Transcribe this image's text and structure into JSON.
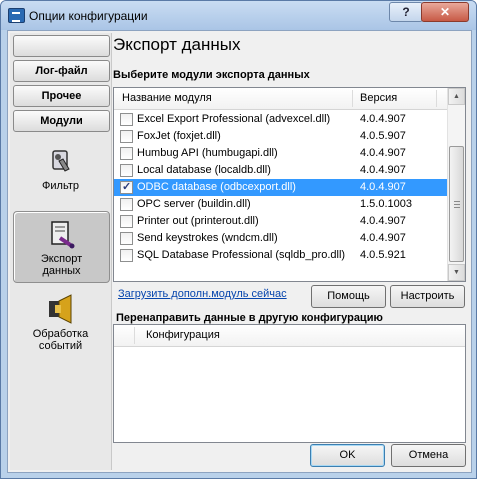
{
  "window": {
    "title": "Опции конфигурации",
    "help_label": "?",
    "close_label": "✕"
  },
  "sidebar": {
    "top_buttons": [
      "",
      "Лог-файл",
      "Прочее",
      "Модули"
    ],
    "nav": [
      {
        "label": "Фильтр",
        "icon": "filter-icon"
      },
      {
        "label": "Экспорт данных",
        "icon": "export-icon",
        "selected": true
      },
      {
        "label": "Обработка событий",
        "icon": "events-icon"
      }
    ]
  },
  "main": {
    "title": "Экспорт данных",
    "modules_group_label": "Выберите модули экспорта данных",
    "columns": {
      "name": "Название модуля",
      "version": "Версия"
    },
    "modules": [
      {
        "name": "Excel Export Professional (advexcel.dll)",
        "version": "4.0.4.907",
        "checked": false
      },
      {
        "name": "FoxJet (foxjet.dll)",
        "version": "4.0.5.907",
        "checked": false
      },
      {
        "name": "Humbug API (humbugapi.dll)",
        "version": "4.0.4.907",
        "checked": false
      },
      {
        "name": "Local database (localdb.dll)",
        "version": "4.0.4.907",
        "checked": false
      },
      {
        "name": "ODBC database (odbcexport.dll)",
        "version": "4.0.4.907",
        "checked": true,
        "selected": true
      },
      {
        "name": "OPC server (buildin.dll)",
        "version": "1.5.0.1003",
        "checked": false
      },
      {
        "name": "Printer out (printerout.dll)",
        "version": "4.0.4.907",
        "checked": false
      },
      {
        "name": "Send keystrokes (wndcm.dll)",
        "version": "4.0.4.907",
        "checked": false
      },
      {
        "name": "SQL Database Professional (sqldb_pro.dll)",
        "version": "4.0.5.921",
        "checked": false
      }
    ],
    "download_link": "Загрузить дополн.модуль сейчас",
    "help_button": "Помощь",
    "configure_button": "Настроить",
    "redirect_group_label": "Перенаправить данные в другую конфигурацию",
    "redirect_column": "Конфигурация"
  },
  "footer": {
    "ok_label": "OK",
    "cancel_label": "Отмена"
  }
}
